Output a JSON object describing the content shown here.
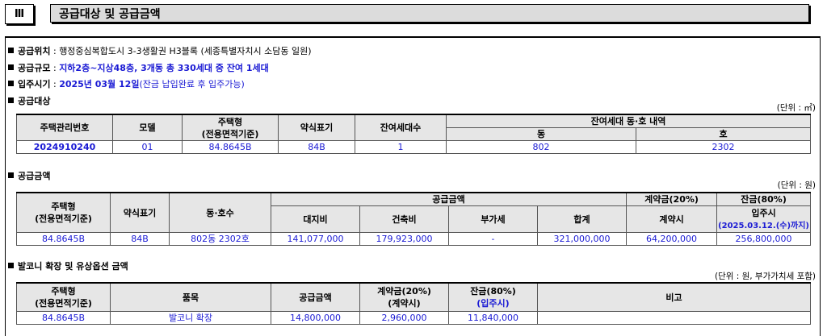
{
  "header": {
    "roman": "Ⅲ",
    "title": "공급대상 및 공급금액"
  },
  "info": {
    "location": {
      "label": "공급위치",
      "sep": " : ",
      "value": "행정중심복합도시 3-3생활권 H3블록 (세종특별자치시 소담동 일원)"
    },
    "scale": {
      "label": "공급규모",
      "sep": " : ",
      "value": "지하2층~지상48층, 3개동 총 330세대 중 잔여 1세대"
    },
    "movein": {
      "label": "입주시기",
      "sep": " : ",
      "value": "2025년 03월 12일",
      "note": "(잔금 납입완료 후 입주가능)"
    },
    "target_label": "공급대상"
  },
  "target_table": {
    "unit": "(단위 : ㎡)",
    "headers": {
      "mgmt_no": "주택관리번호",
      "model": "모델",
      "type": "주택형",
      "type_sub": "(전용면적기준)",
      "abbr": "약식표기",
      "remaining": "잔여세대수",
      "detail": "잔여세대 동·호 내역",
      "dong": "동",
      "ho": "호"
    },
    "row": {
      "mgmt_no": "2024910240",
      "model": "01",
      "type": "84.8645B",
      "abbr": "84B",
      "remaining": "1",
      "dong": "802",
      "ho": "2302"
    }
  },
  "price_section": {
    "label": "공급금액",
    "unit": "(단위 : 원)",
    "headers": {
      "type": "주택형",
      "type_sub": "(전용면적기준)",
      "abbr": "약식표기",
      "dongho": "동·호수",
      "supply": "공급금액",
      "land": "대지비",
      "building": "건축비",
      "vat": "부가세",
      "total": "합계",
      "deposit": "계약금(20%)",
      "deposit_sub": "계약시",
      "balance": "잔금(80%)",
      "balance_sub": "입주시",
      "balance_date": "(2025.03.12.(수)까지)"
    },
    "row": {
      "type": "84.8645B",
      "abbr": "84B",
      "dongho": "802동 2302호",
      "land": "141,077,000",
      "building": "179,923,000",
      "vat": "-",
      "total": "321,000,000",
      "deposit": "64,200,000",
      "balance": "256,800,000"
    }
  },
  "option_section": {
    "label": "발코니 확장 및 유상옵션 금액",
    "unit": "(단위 : 원, 부가가치세 포함)",
    "headers": {
      "type": "주택형",
      "type_sub": "(전용면적기준)",
      "item": "품목",
      "supply": "공급금액",
      "deposit": "계약금(20%)",
      "deposit_sub": "(계약시)",
      "balance": "잔금(80%)",
      "balance_sub": "(입주시)",
      "note": "비고"
    },
    "row": {
      "type": "84.8645B",
      "item": "발코니 확장",
      "supply": "14,800,000",
      "deposit": "2,960,000",
      "balance": "11,840,000",
      "note": ""
    }
  }
}
